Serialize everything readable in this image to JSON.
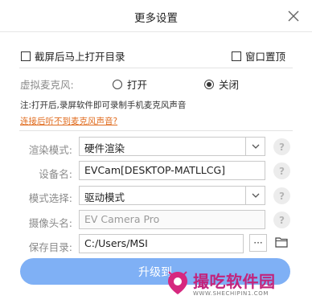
{
  "window": {
    "title": "更多设置"
  },
  "options": {
    "open_dir_after_capture": {
      "label": "截屏后马上打开目录",
      "checked": false
    },
    "window_on_top": {
      "label": "窗口置顶",
      "checked": false
    }
  },
  "virtual_mic": {
    "label": "虚拟麦克风:",
    "on_label": "打开",
    "off_label": "关闭",
    "selected": "off",
    "note": "注:打开后,录屏软件即可录制手机麦克风声音",
    "help_link": "连接后听不到麦克风声音?"
  },
  "settings": {
    "render_mode": {
      "label": "渲染模式:",
      "value": "硬件渲染"
    },
    "device_name": {
      "label": "设备名:",
      "value": "EVCam[DESKTOP-MATLLCG]"
    },
    "mode_select": {
      "label": "模式选择:",
      "value": "驱动模式"
    },
    "camera_name": {
      "label": "摄像头名:",
      "value": "EV Camera Pro"
    },
    "save_dir": {
      "label": "保存目录:",
      "value": "C:/Users/MSI",
      "browse_label": "···"
    }
  },
  "help_glyph": "?",
  "upgrade_button": {
    "label": "升级到"
  },
  "watermark": {
    "text": "撮吃软件园",
    "sub": "WWW.SHECHIPIN1.COM"
  },
  "colors": {
    "accent_button": "#7fb0f5",
    "link": "#e06c1f",
    "watermark": "#c2247c"
  }
}
